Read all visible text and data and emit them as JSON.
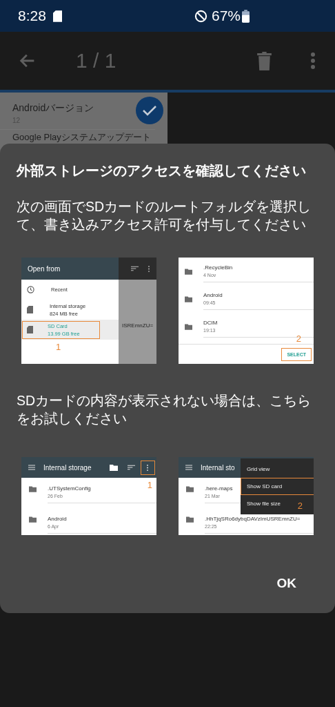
{
  "status_bar": {
    "time": "8:28",
    "battery": "67%"
  },
  "toolbar": {
    "counter": "1 / 1"
  },
  "background_list": [
    {
      "title": "Androidバージョン",
      "subtitle": "12",
      "selected": true
    },
    {
      "title": "Google Playシステムアップデート"
    }
  ],
  "dialog": {
    "title": "外部ストレージのアクセスを確認してください",
    "message": "次の画面でSDカードのルートフォルダを選択して、書き込みアクセス許可を付与してください",
    "step1_images": [
      {
        "kind": "drawer",
        "header": "Open from",
        "behind_text": "ISREmnZU=",
        "step": "1",
        "items": [
          {
            "kind": "recent",
            "title": "Recent",
            "selected": false
          },
          {
            "kind": "storage",
            "title": "Internal storage",
            "subtitle": "824 MB free",
            "selected": false
          },
          {
            "kind": "storage",
            "title": "SD Card",
            "subtitle": "13.99 GB free",
            "selected": true
          }
        ]
      },
      {
        "kind": "picker",
        "step": "2",
        "rows": [
          {
            "title": ".RecycleBin",
            "subtitle": "4 Nov"
          },
          {
            "title": "Android",
            "subtitle": "09:45"
          },
          {
            "title": "DCIM",
            "subtitle": "19:13"
          }
        ],
        "button": "SELECT"
      }
    ],
    "hint": "SDカードの内容が表示されない場合は、こちらをお試しください",
    "step2_images": [
      {
        "kind": "browser",
        "header": "Internal storage",
        "step": "1",
        "rows": [
          {
            "title": ".UTSystemConfig",
            "subtitle": "26 Feb"
          },
          {
            "title": "Android",
            "subtitle": "6 Apr"
          }
        ]
      },
      {
        "kind": "menu",
        "header": "Internal sto",
        "step": "2",
        "rows": [
          {
            "title": ".here-maps",
            "subtitle": "21 Mar"
          },
          {
            "title": ".HhTjqSRo6dybqDAVzImUSREmnZU=",
            "subtitle": "22:25"
          }
        ],
        "menu": [
          {
            "label": "Grid view",
            "selected": false
          },
          {
            "label": "Show SD card",
            "selected": true
          },
          {
            "label": "Show file size",
            "selected": false
          }
        ]
      }
    ],
    "ok_button": "OK"
  }
}
